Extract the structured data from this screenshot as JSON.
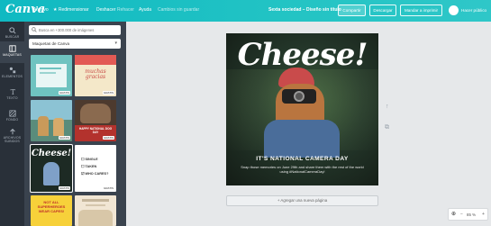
{
  "app": {
    "logo": "Canva"
  },
  "menu": {
    "file": "Archivo",
    "resize": "Redimensionar",
    "undo": "Deshacer",
    "redo": "Rehacer",
    "help": "Ayuda",
    "saved": "Cambios sin guardar"
  },
  "document": {
    "title": "Sexta sociedad – Diseño sin título"
  },
  "actions": {
    "share": "Compartir",
    "download": "Descargar",
    "print": "Mandar a imprimir",
    "make_public": "Hacer público"
  },
  "sidebar": {
    "items": [
      {
        "label": "BUSCAR",
        "icon": "search-icon"
      },
      {
        "label": "MAQUETAS",
        "icon": "layout-icon"
      },
      {
        "label": "ELEMENTOS",
        "icon": "shapes-icon"
      },
      {
        "label": "TEXTO",
        "icon": "text-icon"
      },
      {
        "label": "FONDO",
        "icon": "background-icon"
      },
      {
        "label": "ARCHIVOS SUBIDOS",
        "icon": "upload-icon"
      }
    ]
  },
  "panel": {
    "search_placeholder": "Busca en +300.000 de imágenes",
    "category": "Maquetas de Canva",
    "badge": "GRATIS",
    "thumbs": [
      {
        "text": "",
        "color": "#6fc3c0"
      },
      {
        "text": "muchas gracias",
        "color": "#f4e8c9"
      },
      {
        "text": "",
        "color": "#5a8c7b"
      },
      {
        "text": "HAPPY NATIONAL DOG DAY",
        "color": "#b3322d"
      },
      {
        "text": "Cheese!",
        "color": "#1d2a24"
      },
      {
        "text": "SINGLE · TAKEN · WHO CARES?",
        "color": "#ffffff"
      },
      {
        "text": "NOT ALL SUPERHEROES WEAR CAPES!",
        "color": "#f7d13a"
      },
      {
        "text": "",
        "color": "#f1e6d4"
      }
    ],
    "checklist": [
      "SINGLE",
      "TAKEN",
      "WHO CARES?"
    ]
  },
  "design": {
    "headline": "Cheese!",
    "subtitle": "IT'S NATIONAL CAMERA DAY",
    "body": "Snap those memories on June 29th and share them with the rest of the world using #NationalCameraDay!"
  },
  "canvas": {
    "add_page": "+ Agregar una nueva página",
    "zoom": "85 %"
  }
}
